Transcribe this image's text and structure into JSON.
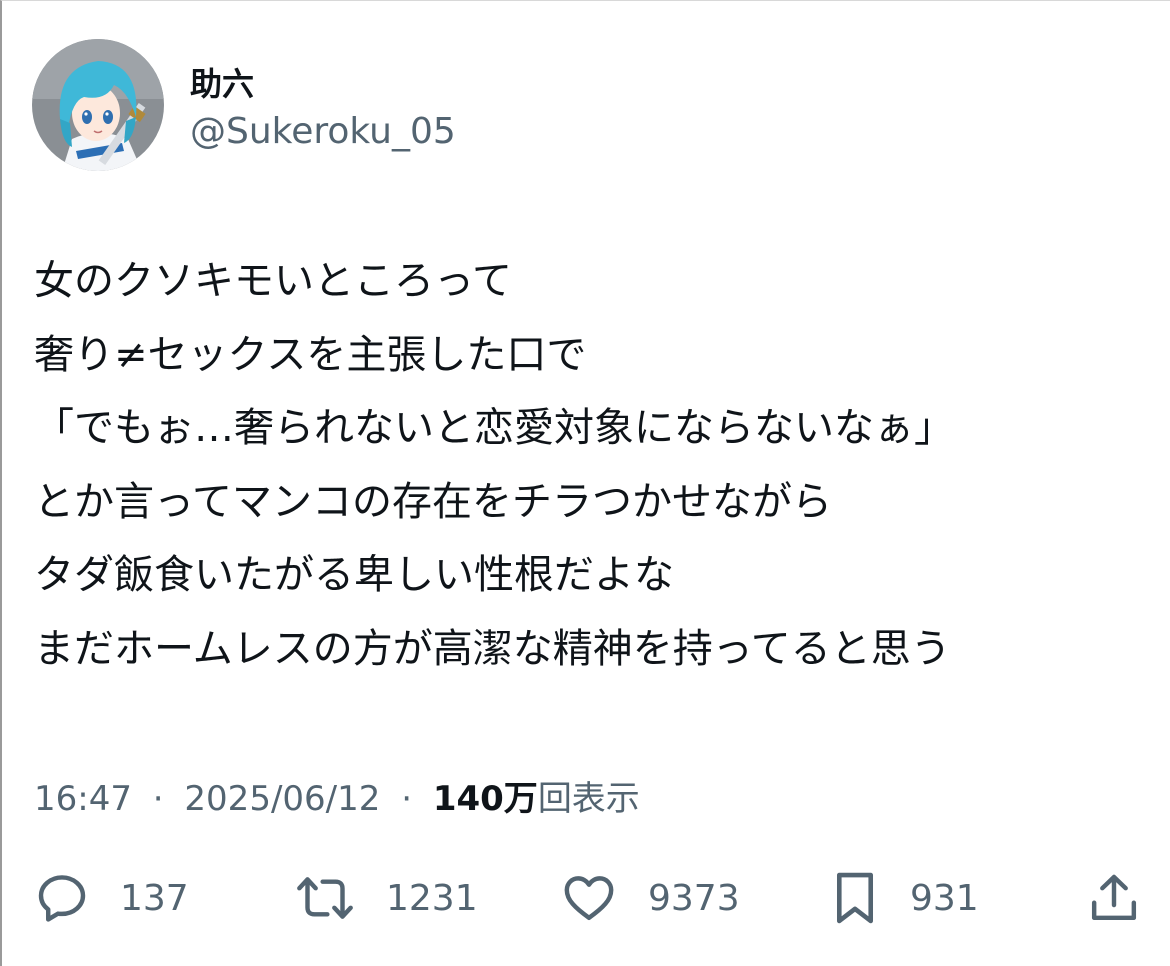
{
  "author": {
    "display_name": "助六",
    "handle": "@Sukeroku_05"
  },
  "tweet": {
    "lines": [
      "女のクソキモいところって",
      "奢り≠セックスを主張した口で",
      "「でもぉ…奢られないと恋愛対象にならないなぁ」",
      "とか言ってマンコの存在をチラつかせながら",
      "タダ飯食いたがる卑しい性根だよな",
      "まだホームレスの方が高潔な精神を持ってると思う"
    ]
  },
  "meta": {
    "time": "16:47",
    "separator": "·",
    "date": "2025/06/12",
    "views_count": "140万",
    "views_label": "回表示"
  },
  "actions": {
    "reply_count": "137",
    "retweet_count": "1231",
    "like_count": "9373",
    "bookmark_count": "931"
  },
  "icons": {
    "reply": "reply-icon",
    "retweet": "retweet-icon",
    "like": "heart-icon",
    "bookmark": "bookmark-icon",
    "share": "share-icon"
  },
  "colors": {
    "text_primary": "#0f1419",
    "text_secondary": "#536471",
    "avatar_hair": "#3fb8d8"
  }
}
